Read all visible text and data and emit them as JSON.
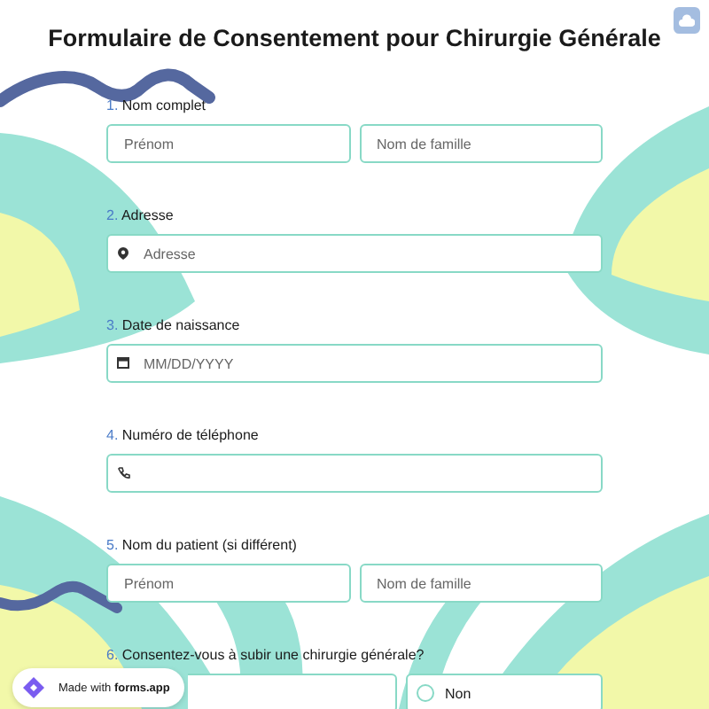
{
  "title": "Formulaire de Consentement pour Chirurgie Générale",
  "questions": [
    {
      "number": "1.",
      "label": "Nom complet",
      "kind": "split",
      "fields": [
        {
          "placeholder": "Prénom"
        },
        {
          "placeholder": "Nom de famille"
        }
      ]
    },
    {
      "number": "2.",
      "label": "Adresse",
      "kind": "address",
      "fields": [
        {
          "placeholder": "Adresse"
        }
      ]
    },
    {
      "number": "3.",
      "label": "Date de naissance",
      "kind": "date",
      "fields": [
        {
          "placeholder": "MM/DD/YYYY"
        }
      ]
    },
    {
      "number": "4.",
      "label": "Numéro de téléphone",
      "kind": "phone"
    },
    {
      "number": "5.",
      "label": "Nom du patient (si différent)",
      "kind": "split",
      "fields": [
        {
          "placeholder": "Prénom"
        },
        {
          "placeholder": "Nom de famille"
        }
      ]
    },
    {
      "number": "6.",
      "label": "Consentez-vous à subir une chirurgie générale?",
      "kind": "choice",
      "options": [
        {
          "label": "Non",
          "selected": false
        }
      ]
    }
  ],
  "badge": "Made with **forms.app**"
}
